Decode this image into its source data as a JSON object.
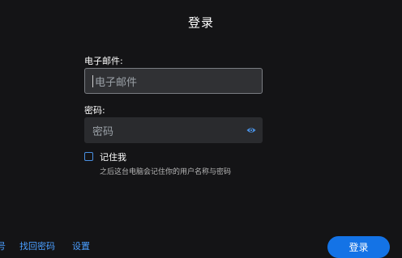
{
  "header": {
    "title": "登录"
  },
  "form": {
    "email": {
      "label": "电子邮件:",
      "placeholder": "电子邮件"
    },
    "password": {
      "label": "密码:",
      "placeholder": "密码",
      "toggle_icon": "eye-icon"
    },
    "remember": {
      "label": "记住我",
      "hint": "之后这台电脑会记住你的用户名称与密码",
      "checked": false
    }
  },
  "footer": {
    "links": [
      "号",
      "找回密码",
      "设置"
    ],
    "login_button": "登录"
  },
  "colors": {
    "background": "#141416",
    "accent": "#1473e6",
    "link": "#4a9eff"
  }
}
